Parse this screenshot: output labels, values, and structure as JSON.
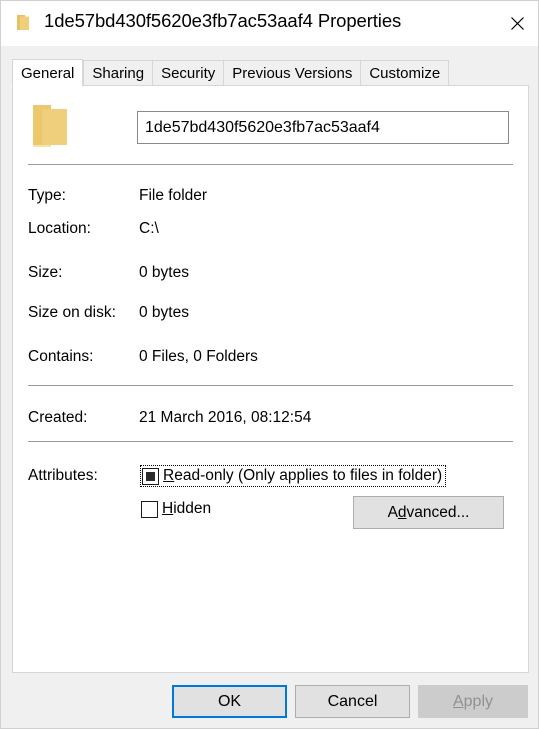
{
  "window": {
    "title": "1de57bd430f5620e3fb7ac53aaf4 Properties",
    "icon": "folder-icon",
    "close_label": "close-icon"
  },
  "tabs": [
    {
      "label": "General",
      "selected": true
    },
    {
      "label": "Sharing",
      "selected": false
    },
    {
      "label": "Security",
      "selected": false
    },
    {
      "label": "Previous Versions",
      "selected": false
    },
    {
      "label": "Customize",
      "selected": false
    }
  ],
  "general": {
    "folder_icon": "folder-icon",
    "name_value": "1de57bd430f5620e3fb7ac53aaf4",
    "name_placeholder": "Folder name",
    "rows": [
      {
        "label": "Type:",
        "value": "File folder"
      },
      {
        "label": "Location:",
        "value": "C:\\"
      },
      {
        "label": "Size:",
        "value": "0 bytes"
      },
      {
        "label": "Size on disk:",
        "value": "0 bytes"
      },
      {
        "label": "Contains:",
        "value": "0 Files, 0 Folders"
      },
      {
        "label": "Created:",
        "value": "21 March 2016, 08:12:54"
      }
    ],
    "attributes": {
      "label": "Attributes:",
      "readonly": {
        "accelerator": "R",
        "text": "ead-only (Only applies to files in folder)",
        "state": "indeterminate",
        "focused": true
      },
      "hidden": {
        "accelerator": "H",
        "text": "idden",
        "state": "unchecked",
        "focused": false
      },
      "advanced_prefix": "A",
      "advanced_accelerator": "d",
      "advanced_suffix": "vanced..."
    }
  },
  "footer": {
    "ok": "OK",
    "cancel": "Cancel",
    "apply_accelerator": "A",
    "apply_suffix": "pply",
    "apply_enabled": false
  },
  "colors": {
    "accent": "#0078d7",
    "dialog_bg": "#f0f0f0",
    "panel_bg": "#ffffff",
    "button_bg": "#e1e1e1",
    "disabled_text": "#919191",
    "folder_yellow": "#f0cf7c"
  }
}
